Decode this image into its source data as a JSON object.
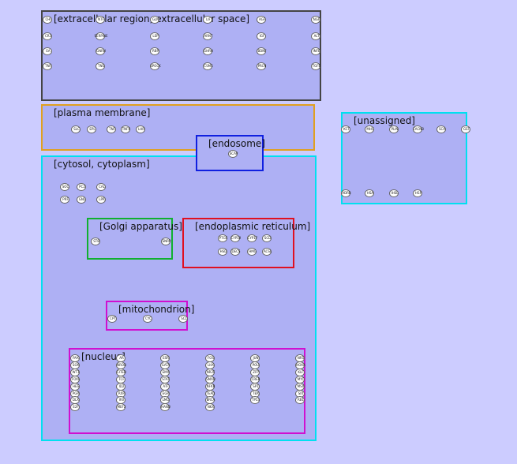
{
  "compartments": [
    {
      "id": "extracellular",
      "label": "[extracellular region, extracellular space]",
      "color": "#444444"
    },
    {
      "id": "plasma",
      "label": "[plasma membrane]",
      "color": "#e0a020"
    },
    {
      "id": "unassigned",
      "label": "[unassigned]",
      "color": "#00e0f0"
    },
    {
      "id": "endosome",
      "label": "[endosome]",
      "color": "#1020e0"
    },
    {
      "id": "cytosol",
      "label": "[cytosol, cytoplasm]",
      "color": "#00e0f0"
    },
    {
      "id": "golgi",
      "label": "[Golgi apparatus]",
      "color": "#10b030"
    },
    {
      "id": "er",
      "label": "[endoplasmic reticulum]",
      "color": "#e01020"
    },
    {
      "id": "mito",
      "label": "[mitochondrion]",
      "color": "#d010d0"
    },
    {
      "id": "nucleus",
      "label": "[nucleus]",
      "color": "#d010d0"
    }
  ],
  "nodes": {
    "extracellular": [
      "CHI",
      "NTF",
      "GLN",
      "LIF",
      "AGF",
      "NGF",
      "CR3",
      "SERPINE",
      "LEP",
      "ARNT",
      "IGF",
      "ALT",
      "EA",
      "GNRH",
      "RBP",
      "GHRH",
      "BDNF",
      "INFE",
      "TNF",
      "TNS",
      "SPOCK",
      "CSMS",
      "PRCN",
      "TGFB"
    ],
    "plasma": [
      "SLC",
      "EPL",
      "TNF",
      "TNFR",
      "LHR"
    ],
    "unassigned": [
      "KCT",
      "MHC",
      "PLIN",
      "CACNB",
      "SCA",
      "GST",
      "ADRB",
      "HSA",
      "IHSL",
      "HSP"
    ],
    "endosome": [
      "SCAP"
    ],
    "cytosol": [
      "SOC",
      "PC2",
      "CAL",
      "PRF",
      "GNL",
      "LPR"
    ],
    "golgi": [
      "ST8",
      "SNRP"
    ],
    "er": [
      "PTGS",
      "CYP19",
      "CYP17",
      "SCD",
      "HSD",
      "DECS",
      "HMG",
      "ACSL"
    ],
    "mito": [
      "CPT",
      "CYC",
      "SCL"
    ],
    "nucleus": [
      "PAX",
      "AR",
      "ESR",
      "FOS",
      "JUN",
      "NR5",
      "SOX",
      "NROB",
      "GATA",
      "LHX",
      "POU",
      "HOXA",
      "WT1",
      "CITED",
      "EMX",
      "NR2F",
      "ZFP",
      "KLF",
      "FOXL",
      "TCF",
      "STAT",
      "SMAD",
      "CREB",
      "MYC",
      "HES",
      "ID2",
      "ATF",
      "NFKB",
      "SP1",
      "MSX",
      "PGR",
      "RXR",
      "EGR",
      "TEAD",
      "TBX",
      "SIX",
      "DLX",
      "IRX",
      "LMO",
      "BRCA",
      "TP53",
      "RB1",
      "E2F",
      "MEF2",
      "HAND",
      "NKX"
    ]
  }
}
